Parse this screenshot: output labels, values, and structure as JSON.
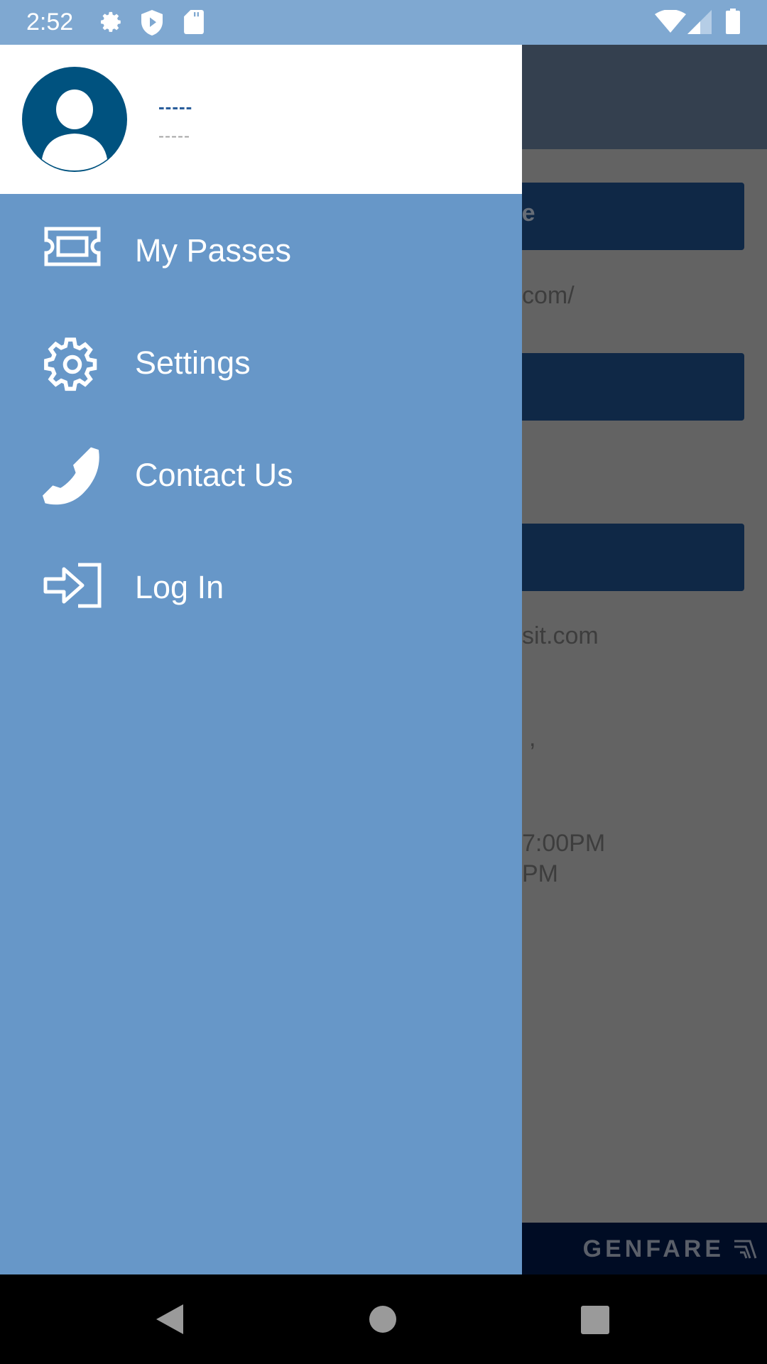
{
  "status_bar": {
    "time": "2:52",
    "icons": [
      "gear-icon",
      "shield-play-icon",
      "sd-card-icon",
      "wifi-icon",
      "signal-icon",
      "battery-icon"
    ]
  },
  "drawer": {
    "user": {
      "name": "-----",
      "subtitle": "-----"
    },
    "items": [
      {
        "label": "My Passes",
        "icon": "ticket-icon"
      },
      {
        "label": "Settings",
        "icon": "gear-icon"
      },
      {
        "label": "Contact Us",
        "icon": "phone-icon"
      },
      {
        "label": "Log In",
        "icon": "login-icon"
      }
    ]
  },
  "background": {
    "button1": "site",
    "text1": "com/",
    "text2": "sit.com",
    "text3": ",",
    "text4": "7:00PM",
    "text5": "PM",
    "footer_logo": "GENFARE"
  },
  "colors": {
    "status": "#7fa8d1",
    "drawer": "#6797c8",
    "avatar": "#00527f",
    "button": "#0f2846"
  }
}
